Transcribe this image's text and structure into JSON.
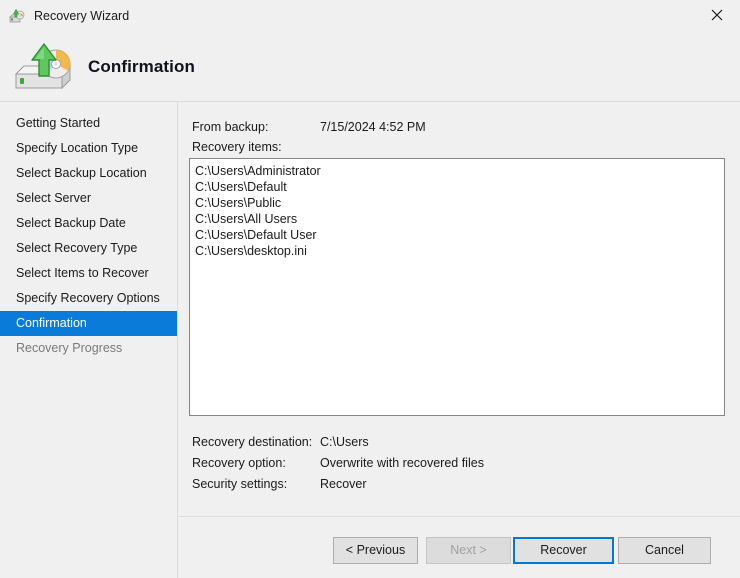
{
  "window": {
    "title": "Recovery Wizard",
    "icon": "recovery-disk-icon",
    "close_label": "✕"
  },
  "header": {
    "title": "Confirmation",
    "icon": "backup-drive-disc-icon"
  },
  "sidebar": {
    "items": [
      {
        "label": "Getting Started",
        "state": "normal"
      },
      {
        "label": "Specify Location Type",
        "state": "normal"
      },
      {
        "label": "Select Backup Location",
        "state": "normal"
      },
      {
        "label": "Select Server",
        "state": "normal"
      },
      {
        "label": "Select Backup Date",
        "state": "normal"
      },
      {
        "label": "Select Recovery Type",
        "state": "normal"
      },
      {
        "label": "Select Items to Recover",
        "state": "normal"
      },
      {
        "label": "Specify Recovery Options",
        "state": "normal"
      },
      {
        "label": "Confirmation",
        "state": "selected"
      },
      {
        "label": "Recovery Progress",
        "state": "disabled"
      }
    ],
    "selected_color": "#0a7bd8"
  },
  "main": {
    "from_backup_label": "From backup:",
    "from_backup_value": "7/15/2024 4:52 PM",
    "recovery_items_label": "Recovery items:",
    "recovery_items": [
      "C:\\Users\\Administrator",
      "C:\\Users\\Default",
      "C:\\Users\\Public",
      "C:\\Users\\All Users",
      "C:\\Users\\Default User",
      "C:\\Users\\desktop.ini"
    ],
    "summary": [
      {
        "label": "Recovery destination:",
        "value": "C:\\Users"
      },
      {
        "label": "Recovery option:",
        "value": "Overwrite with recovered files"
      },
      {
        "label": "Security settings:",
        "value": "Recover"
      }
    ]
  },
  "buttons": {
    "previous": "< Previous",
    "next": "Next >",
    "recover": "Recover",
    "cancel": "Cancel",
    "default_focus_color": "#0078d7"
  }
}
